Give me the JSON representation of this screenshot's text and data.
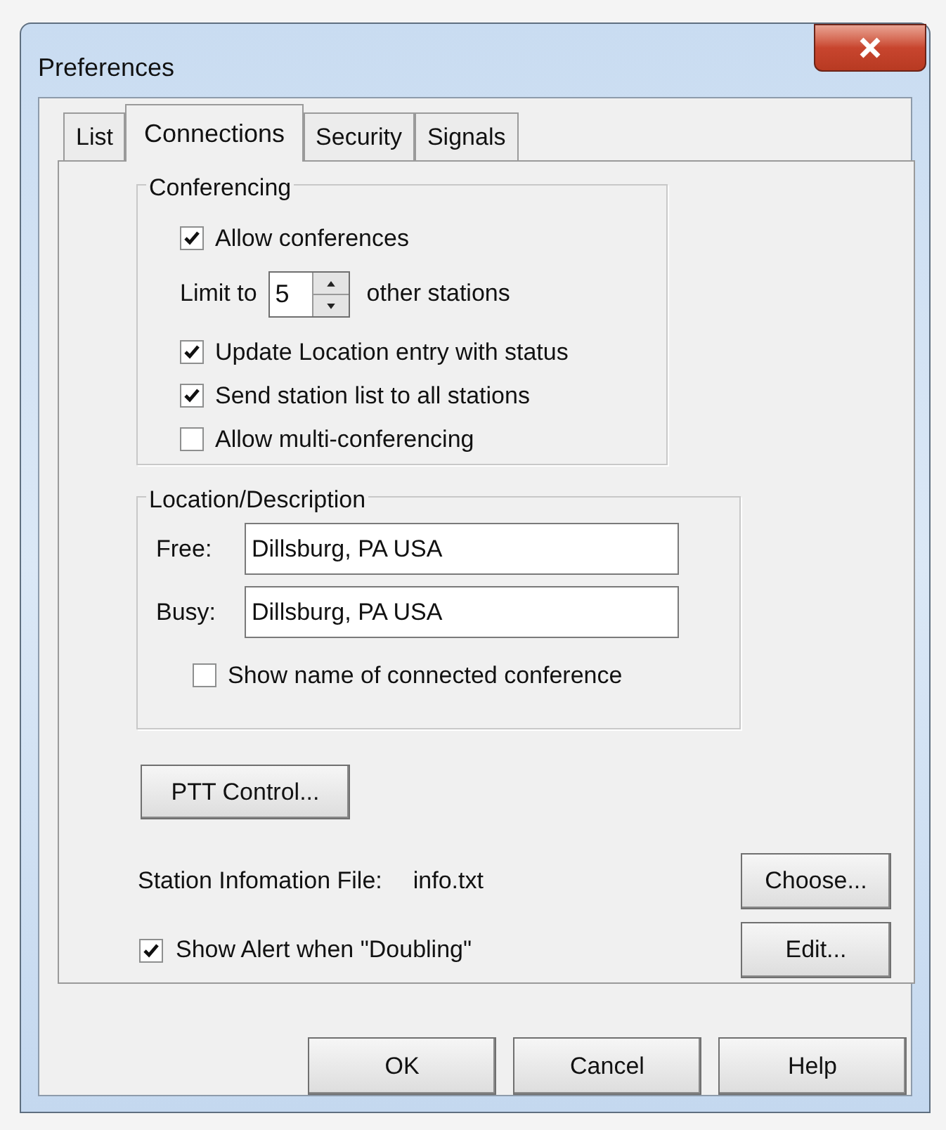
{
  "window": {
    "title": "Preferences"
  },
  "tabs": [
    {
      "label": "List",
      "selected": false
    },
    {
      "label": "Connections",
      "selected": true
    },
    {
      "label": "Security",
      "selected": false
    },
    {
      "label": "Signals",
      "selected": false
    }
  ],
  "conferencing": {
    "title": "Conferencing",
    "items": [
      {
        "kind": "checkbox",
        "label": "Allow conferences",
        "checked": true
      },
      {
        "kind": "spinner",
        "label": "Limit to",
        "value": "5",
        "suffix": "other stations"
      },
      {
        "kind": "checkbox",
        "label": "Update Location entry with status",
        "checked": true
      },
      {
        "kind": "checkbox",
        "label": "Send station list to all stations",
        "checked": true
      },
      {
        "kind": "checkbox",
        "label": "Allow multi-conferencing",
        "checked": false
      }
    ]
  },
  "location": {
    "title": "Location/Description",
    "fields": [
      {
        "label": "Free:",
        "value": "Dillsburg, PA USA"
      },
      {
        "label": "Busy:",
        "value": "Dillsburg, PA USA"
      }
    ],
    "option": {
      "label": "Show name of connected conference",
      "checked": false
    }
  },
  "ptt_button": "PTT Control...",
  "station_file": {
    "label": "Station Infomation File:",
    "value": "info.txt"
  },
  "choose_button": "Choose...",
  "alert_option": {
    "label": "Show Alert when \"Doubling\"",
    "checked": true
  },
  "edit_button": "Edit...",
  "buttons": [
    "OK",
    "Cancel",
    "Help"
  ]
}
